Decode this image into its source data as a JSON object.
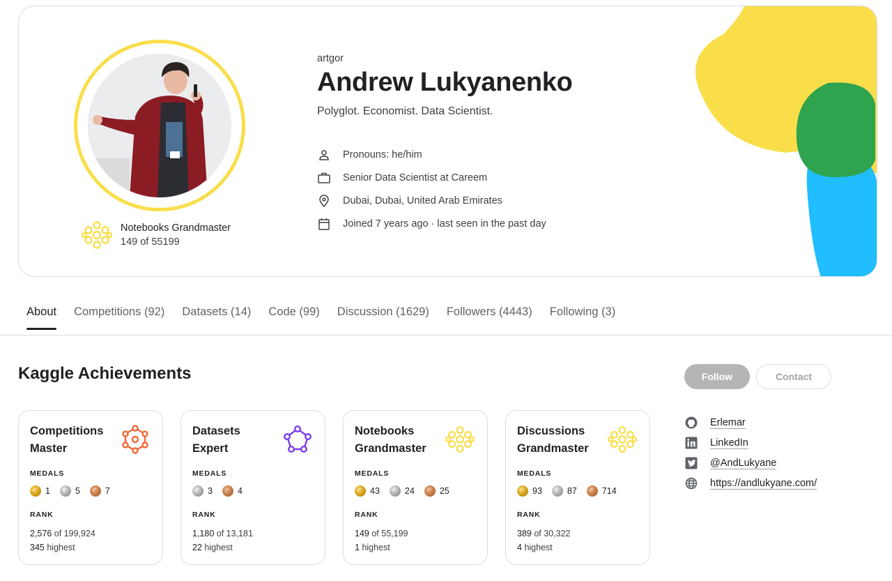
{
  "profile": {
    "username": "artgor",
    "name": "Andrew Lukyanenko",
    "bio": "Polyglot. Economist. Data Scientist.",
    "tier_title": "Notebooks Grandmaster",
    "tier_rank": "149 of 55199",
    "details": [
      {
        "icon": "person-icon",
        "text": "Pronouns: he/him"
      },
      {
        "icon": "briefcase-icon",
        "text": "Senior Data Scientist at Careem"
      },
      {
        "icon": "location-pin-icon",
        "text": "Dubai, Dubai, United Arab Emirates"
      },
      {
        "icon": "calendar-icon",
        "text": "Joined 7 years ago · last seen in the past day"
      }
    ]
  },
  "tabs": [
    {
      "label": "About",
      "active": true
    },
    {
      "label": "Competitions (92)"
    },
    {
      "label": "Datasets (14)"
    },
    {
      "label": "Code (99)"
    },
    {
      "label": "Discussion (1629)"
    },
    {
      "label": "Followers (4443)"
    },
    {
      "label": "Following (3)"
    }
  ],
  "achievements": {
    "title": "Kaggle Achievements",
    "medals_label": "MEDALS",
    "rank_label": "RANK",
    "cards": [
      {
        "title": "Competitions Master",
        "icon": "competitions-master-icon",
        "icon_color": "#f16837",
        "medals": [
          {
            "type": "gold",
            "count": "1"
          },
          {
            "type": "silver",
            "count": "5"
          },
          {
            "type": "bronze",
            "count": "7"
          }
        ],
        "rank": "2,576",
        "rank_of": "of 199,924",
        "highest": "345",
        "highest_label": "highest"
      },
      {
        "title": "Datasets Expert",
        "icon": "datasets-expert-icon",
        "icon_color": "#7c3aed",
        "medals": [
          {
            "type": "silver",
            "count": "3"
          },
          {
            "type": "bronze",
            "count": "4"
          }
        ],
        "rank": "1,180",
        "rank_of": "of 13,181",
        "highest": "22",
        "highest_label": "highest"
      },
      {
        "title": "Notebooks Grandmaster",
        "icon": "notebooks-grandmaster-icon",
        "icon_color": "#f9de4a",
        "medals": [
          {
            "type": "gold",
            "count": "43"
          },
          {
            "type": "silver",
            "count": "24"
          },
          {
            "type": "bronze",
            "count": "25"
          }
        ],
        "rank": "149",
        "rank_of": "of 55,199",
        "highest": "1",
        "highest_label": "highest"
      },
      {
        "title": "Discussions Grandmaster",
        "icon": "discussions-grandmaster-icon",
        "icon_color": "#f9de4a",
        "medals": [
          {
            "type": "gold",
            "count": "93"
          },
          {
            "type": "silver",
            "count": "87"
          },
          {
            "type": "bronze",
            "count": "714"
          }
        ],
        "rank": "389",
        "rank_of": "of 30,322",
        "highest": "4",
        "highest_label": "highest"
      }
    ]
  },
  "actions": {
    "follow": "Follow",
    "contact": "Contact"
  },
  "links": [
    {
      "icon": "github-icon",
      "text": "Erlemar"
    },
    {
      "icon": "linkedin-icon",
      "text": "LinkedIn"
    },
    {
      "icon": "twitter-icon",
      "text": "@AndLukyane"
    },
    {
      "icon": "globe-icon",
      "text": "https://andlukyane.com/"
    }
  ],
  "colors": {
    "yellow": "#f9de4a",
    "green": "#2ea44f",
    "blue": "#20beff",
    "orange": "#f16837",
    "purple": "#7c3aed"
  }
}
